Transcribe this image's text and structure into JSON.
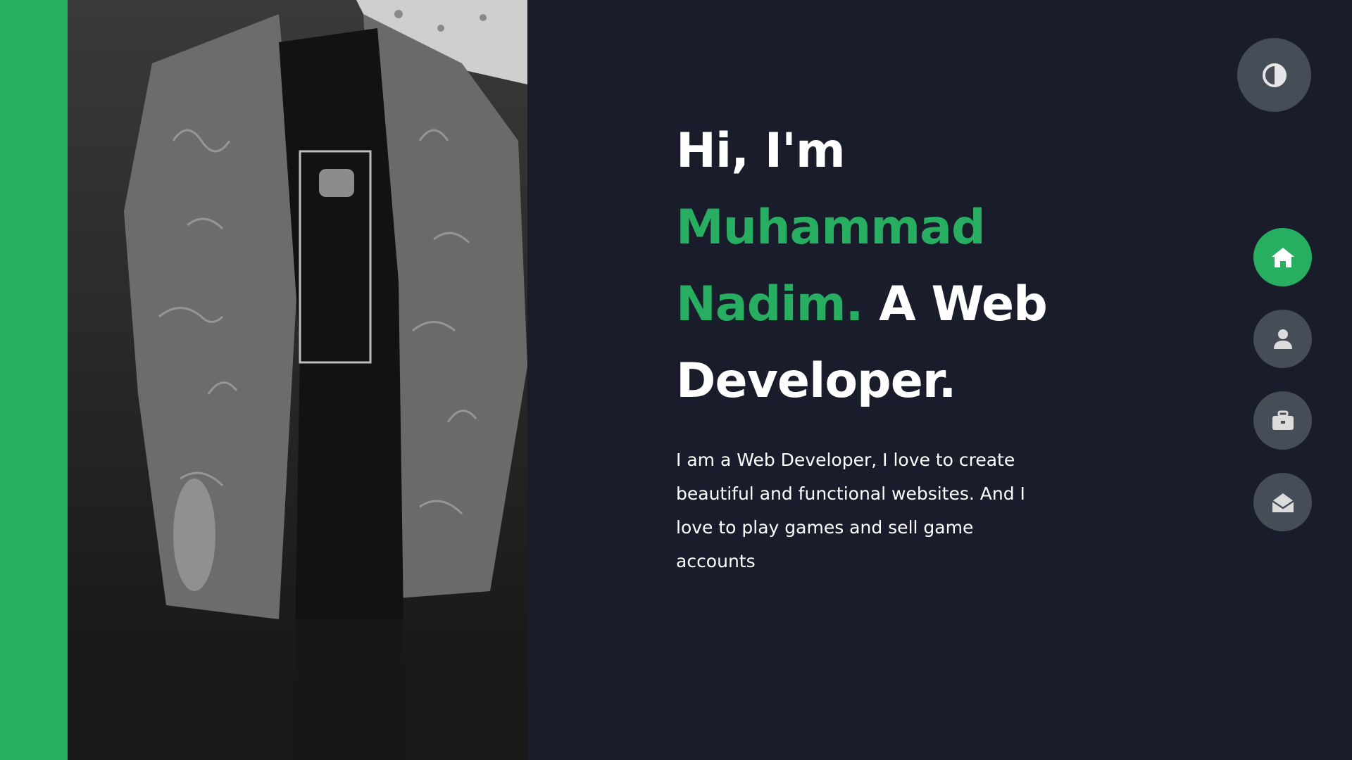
{
  "colors": {
    "background": "#191d2b",
    "accent": "#27ae60",
    "button_bg": "#454e56",
    "text": "#ffffff",
    "icon_inactive": "#dcdcdc"
  },
  "photo": {
    "description_alt": "portrait photo"
  },
  "hero": {
    "greeting": "Hi, I'm ",
    "name": "Muhammad Nadim.",
    "role": " A Web Developer.",
    "description": "I am a Web Developer, I love to create beautiful and functional websites. And I love to play games and sell game accounts"
  },
  "theme_toggle": {
    "icon": "contrast-icon"
  },
  "nav": {
    "items": [
      {
        "icon": "home-icon",
        "active": true
      },
      {
        "icon": "user-icon",
        "active": false
      },
      {
        "icon": "briefcase-icon",
        "active": false
      },
      {
        "icon": "envelope-open-icon",
        "active": false
      }
    ]
  }
}
